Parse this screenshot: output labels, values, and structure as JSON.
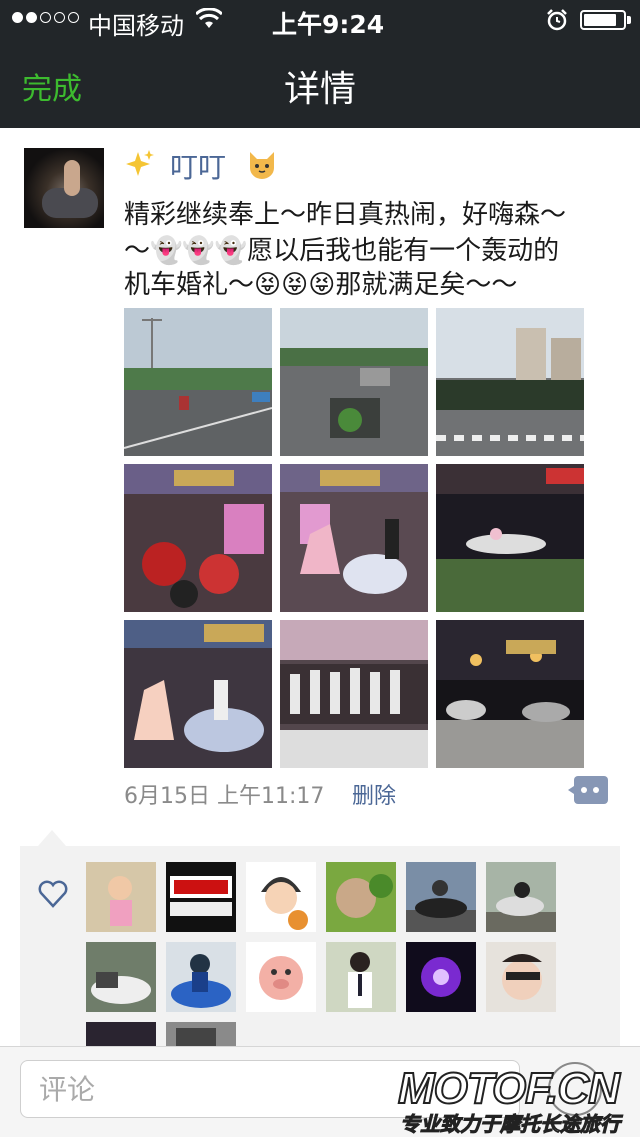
{
  "status_bar": {
    "carrier": "中国移动",
    "time": "上午9:24",
    "signal_bars_filled": 2,
    "signal_bars_total": 5,
    "battery_level": 0.85
  },
  "nav": {
    "done_label": "完成",
    "title": "详情"
  },
  "post": {
    "user_name": "叮叮",
    "text_lines": [
      "精彩继续奉上～昨日真热闹，好嗨森～",
      "～👻👻👻愿以后我也能有一个轰动的",
      "机车婚礼～😝😝😝那就满足矣～～"
    ],
    "photo_count": 9,
    "time": "6月15日  上午11:17",
    "delete_label": "删除"
  },
  "likes": {
    "avatar_count": 14
  },
  "comment_bar": {
    "placeholder": "评论"
  },
  "watermark": {
    "brand": "MOTOF.CN",
    "tagline": "专业致力于摩托长途旅行"
  },
  "colors": {
    "header_bg": "#222629",
    "accent_green": "#3dbb2f",
    "link_blue": "#4b6796"
  }
}
